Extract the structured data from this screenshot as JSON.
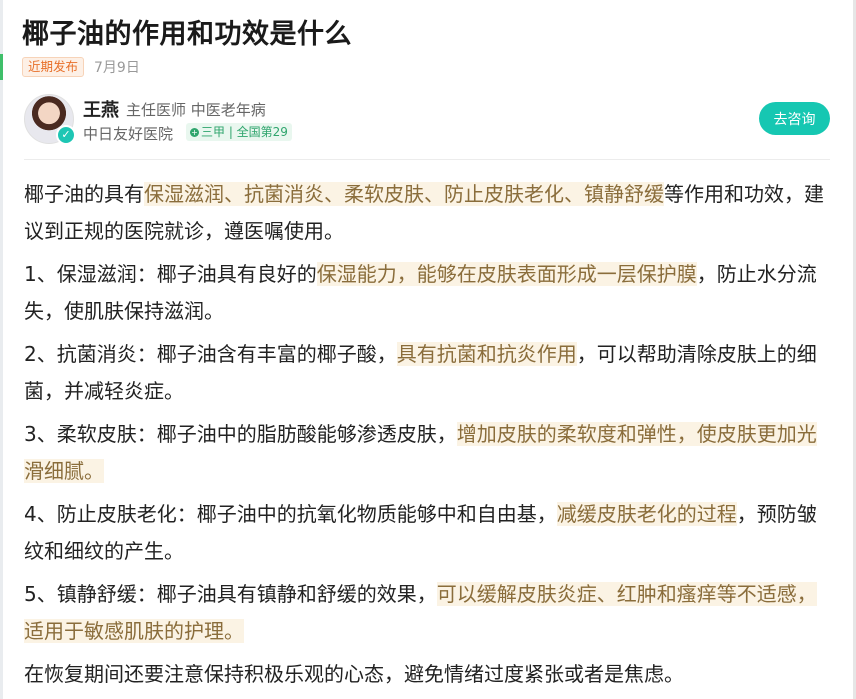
{
  "article": {
    "title": "椰子油的作用和功效是什么",
    "badge": "近期发布",
    "date": "7月9日"
  },
  "doctor": {
    "name": "王燕",
    "titles": "主任医师  中医老年病",
    "hospital": "中日友好医院",
    "rank": "三甲 | 全国第29",
    "consult_label": "去咨询",
    "verify_mark": "✓"
  },
  "paragraphs": [
    {
      "pre": "椰子油的具有",
      "hl": "保湿滋润、抗菌消炎、柔软皮肤、防止皮肤老化、镇静舒缓",
      "post": "等作用和功效，建议到正规的医院就诊，遵医嘱使用。"
    },
    {
      "pre": "1、保湿滋润：椰子油具有良好的",
      "hl": "保湿能力，能够在皮肤表面形成一层保护膜",
      "post": "，防止水分流失，使肌肤保持滋润。"
    },
    {
      "pre": "2、抗菌消炎：椰子油含有丰富的椰子酸，",
      "hl": "具有抗菌和抗炎作用",
      "post": "，可以帮助清除皮肤上的细菌，并减轻炎症。"
    },
    {
      "pre": "3、柔软皮肤：椰子油中的脂肪酸能够渗透皮肤，",
      "hl": "增加皮肤的柔软度和弹性，使皮肤更加光滑细腻。",
      "post": ""
    },
    {
      "pre": "4、防止皮肤老化：椰子油中的抗氧化物质能够中和自由基，",
      "hl": "减缓皮肤老化的过程",
      "post": "，预防皱纹和细纹的产生。"
    },
    {
      "pre": "5、镇静舒缓：椰子油具有镇静和舒缓的效果，",
      "hl": "可以缓解皮肤炎症、红肿和瘙痒等不适感，适用于敏感肌肤的护理。",
      "post": ""
    },
    {
      "pre": "在恢复期间还要注意保持积极乐观的心态，避免情绪过度紧张或者是焦虑。",
      "hl": "",
      "post": ""
    }
  ]
}
